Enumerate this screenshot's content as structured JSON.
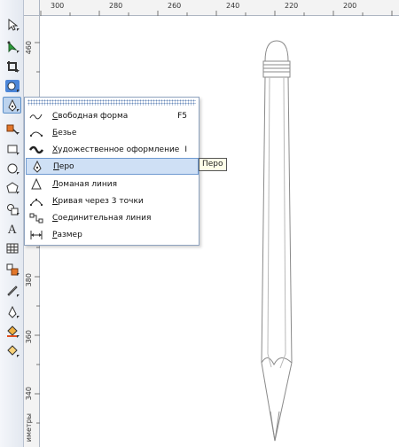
{
  "ruler": {
    "top_labels": [
      "300",
      "280",
      "260",
      "240",
      "220",
      "200"
    ],
    "left_labels": [
      "460",
      "380",
      "360",
      "340"
    ],
    "unit_label": "иметры"
  },
  "toolbox": {
    "tools": [
      "pick-tool-icon",
      "shape-tool-icon",
      "crop-tool-icon",
      "zoom-tool-icon",
      "pen-curve-tool-icon",
      "smart-fill-icon",
      "rectangle-tool-icon",
      "ellipse-tool-icon",
      "polygon-tool-icon",
      "basic-shapes-icon",
      "text-tool-icon",
      "table-tool-icon",
      "interactive-blend-icon",
      "eyedropper-icon",
      "outline-pen-icon",
      "fill-tool-icon",
      "interactive-fill-icon"
    ]
  },
  "menu": {
    "items": [
      {
        "label": "Свободная форма",
        "underline_index": 0,
        "shortcut": "F5",
        "icon": "freehand-icon"
      },
      {
        "label": "Безье",
        "underline_index": 0,
        "shortcut": "",
        "icon": "bezier-icon"
      },
      {
        "label": "Художественное оформление",
        "underline_index": 0,
        "shortcut": "I",
        "icon": "artistic-media-icon"
      },
      {
        "label": "Перо",
        "underline_index": 0,
        "shortcut": "",
        "icon": "pen-icon"
      },
      {
        "label": "Ломаная линия",
        "underline_index": 0,
        "shortcut": "",
        "icon": "polyline-icon"
      },
      {
        "label": "Кривая через 3 точки",
        "underline_index": 0,
        "shortcut": "",
        "icon": "three-point-curve-icon"
      },
      {
        "label": "Соединительная линия",
        "underline_index": 0,
        "shortcut": "",
        "icon": "connector-line-icon"
      },
      {
        "label": "Размер",
        "underline_index": 0,
        "shortcut": "",
        "icon": "dimension-icon"
      }
    ]
  },
  "tooltip": {
    "text": "Перо"
  }
}
